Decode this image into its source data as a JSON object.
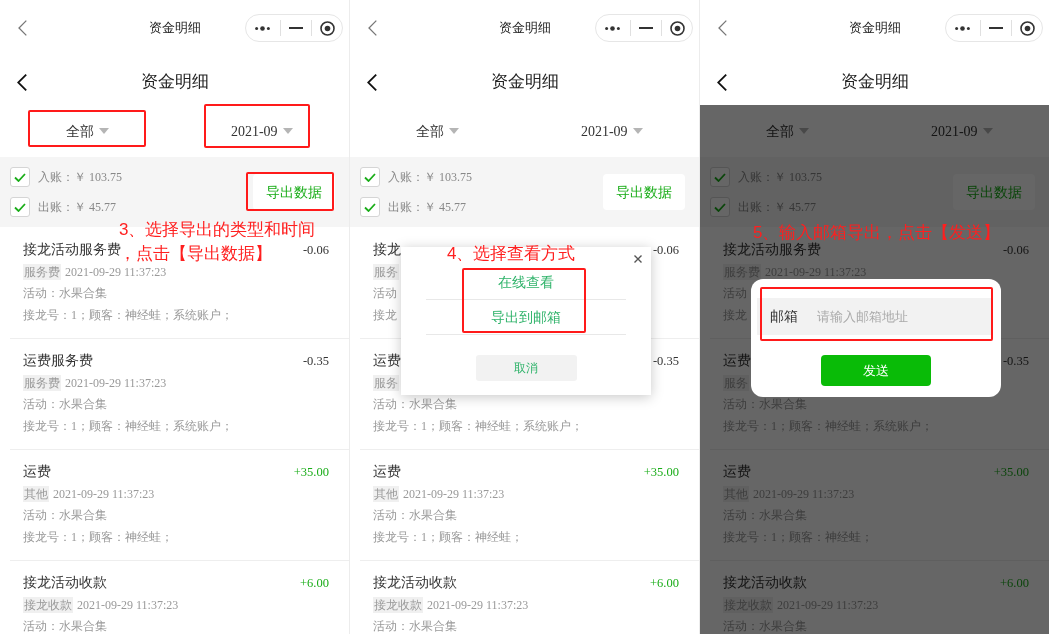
{
  "screens": [
    {
      "top_bar": {
        "title": "资金明细"
      },
      "header": {
        "title": "资金明细"
      },
      "filters": [
        {
          "label": "全部",
          "highlighted": true
        },
        {
          "label": "2021-09",
          "highlighted": true
        }
      ],
      "summary": {
        "rows": [
          {
            "label": "入账：￥ 103.75",
            "checked": true
          },
          {
            "label": "出账：￥ 45.77",
            "checked": true
          }
        ],
        "export_button": {
          "label": "导出数据",
          "highlighted": true
        }
      },
      "records": [
        {
          "title": "接龙活动服务费",
          "amount": "-0.06",
          "color": "#333333",
          "tag": "服务费",
          "time": "2021-09-29 11:37:23",
          "activity": "活动：水果合集",
          "detail": "接龙号：1；顾客：神经蛙；系统账户；"
        },
        {
          "title": "运费服务费",
          "amount": "-0.35",
          "color": "#333333",
          "tag": "服务费",
          "time": "2021-09-29 11:37:23",
          "activity": "活动：水果合集",
          "detail": "接龙号：1；顾客：神经蛙；系统账户；"
        },
        {
          "title": "运费",
          "amount": "+35.00",
          "color": "#1aad19",
          "tag": "其他",
          "time": "2021-09-29 11:37:23",
          "activity": "活动：水果合集",
          "detail": "接龙号：1；顾客：神经蛙；"
        },
        {
          "title": "接龙活动收款",
          "amount": "+6.00",
          "color": "#1aad19",
          "tag": "接龙收款",
          "time": "2021-09-29 11:37:23",
          "activity": "活动：水果合集"
        }
      ],
      "annotation": {
        "lines": [
          "3、选择导出的类型和时间",
          "，点击【导出数据】"
        ]
      }
    },
    {
      "top_bar": {
        "title": "资金明细"
      },
      "header": {
        "title": "资金明细"
      },
      "filters": [
        {
          "label": "全部",
          "highlighted": false
        },
        {
          "label": "2021-09",
          "highlighted": false
        }
      ],
      "summary": {
        "rows": [
          {
            "label": "入账：￥ 103.75",
            "checked": true
          },
          {
            "label": "出账：￥ 45.77",
            "checked": true
          }
        ],
        "export_button": {
          "label": "导出数据",
          "highlighted": false
        }
      },
      "records": [
        {
          "title": "接龙",
          "amount": "-0.06",
          "color": "#333333",
          "tag": "服务",
          "activity": "活动",
          "detail": "接龙"
        },
        {
          "title": "运费",
          "amount": "-0.35",
          "color": "#333333",
          "tag": "服务",
          "activity": "活动：水果合集",
          "detail": "接龙号：1；顾客：神经蛙；系统账户；"
        },
        {
          "title": "运费",
          "amount": "+35.00",
          "color": "#1aad19",
          "tag": "其他",
          "time": "2021-09-29 11:37:23",
          "activity": "活动：水果合集",
          "detail": "接龙号：1；顾客：神经蛙；"
        },
        {
          "title": "接龙活动收款",
          "amount": "+6.00",
          "color": "#1aad19",
          "tag": "接龙收款",
          "time": "2021-09-29 11:37:23",
          "activity": "活动：水果合集"
        }
      ],
      "dialog": {
        "kind": "action_sheet",
        "options": [
          {
            "label": "在线查看"
          },
          {
            "label": "导出到邮箱"
          }
        ],
        "options_highlighted": true,
        "cancel": "取消"
      },
      "annotation": {
        "lines": [
          "4、选择查看方式"
        ]
      }
    },
    {
      "top_bar": {
        "title": "资金明细"
      },
      "header": {
        "title": "资金明细"
      },
      "filters": [
        {
          "label": "全部",
          "highlighted": false
        },
        {
          "label": "2021-09",
          "highlighted": false
        }
      ],
      "summary": {
        "rows": [
          {
            "label": "入账：￥ 103.75",
            "checked": true
          },
          {
            "label": "出账：￥ 45.77",
            "checked": true
          }
        ],
        "export_button": {
          "label": "导出数据",
          "highlighted": false
        }
      },
      "records": [
        {
          "title": "接龙活动服务费",
          "amount": "-0.06",
          "color": "#141414",
          "tag": "服务费",
          "time": "2021-09-29 11:37:23",
          "activity": "活动",
          "detail": "接龙"
        },
        {
          "title": "运费",
          "amount": "-0.35",
          "color": "#141414",
          "tag": "服务",
          "activity": "活动：水果合集",
          "detail": "接龙号：1；顾客：神经蛙；系统账户；"
        },
        {
          "title": "运费",
          "amount": "+35.00",
          "color": "#0a450a",
          "tag": "其他",
          "time": "2021-09-29 11:37:23",
          "activity": "活动：水果合集",
          "detail": "接龙号：1；顾客：神经蛙；"
        },
        {
          "title": "接龙活动收款",
          "amount": "+6.00",
          "color": "#0a450a",
          "tag": "接龙收款",
          "time": "2021-09-29 11:37:23",
          "activity": "活动：水果合集"
        }
      ],
      "dimmed": true,
      "dialog": {
        "kind": "email_form",
        "field_label": "邮箱",
        "placeholder": "请输入邮箱地址",
        "field_highlighted": true,
        "submit": "发送"
      },
      "annotation": {
        "lines": [
          "5、输入邮箱导出，点击【发送】"
        ]
      }
    }
  ]
}
